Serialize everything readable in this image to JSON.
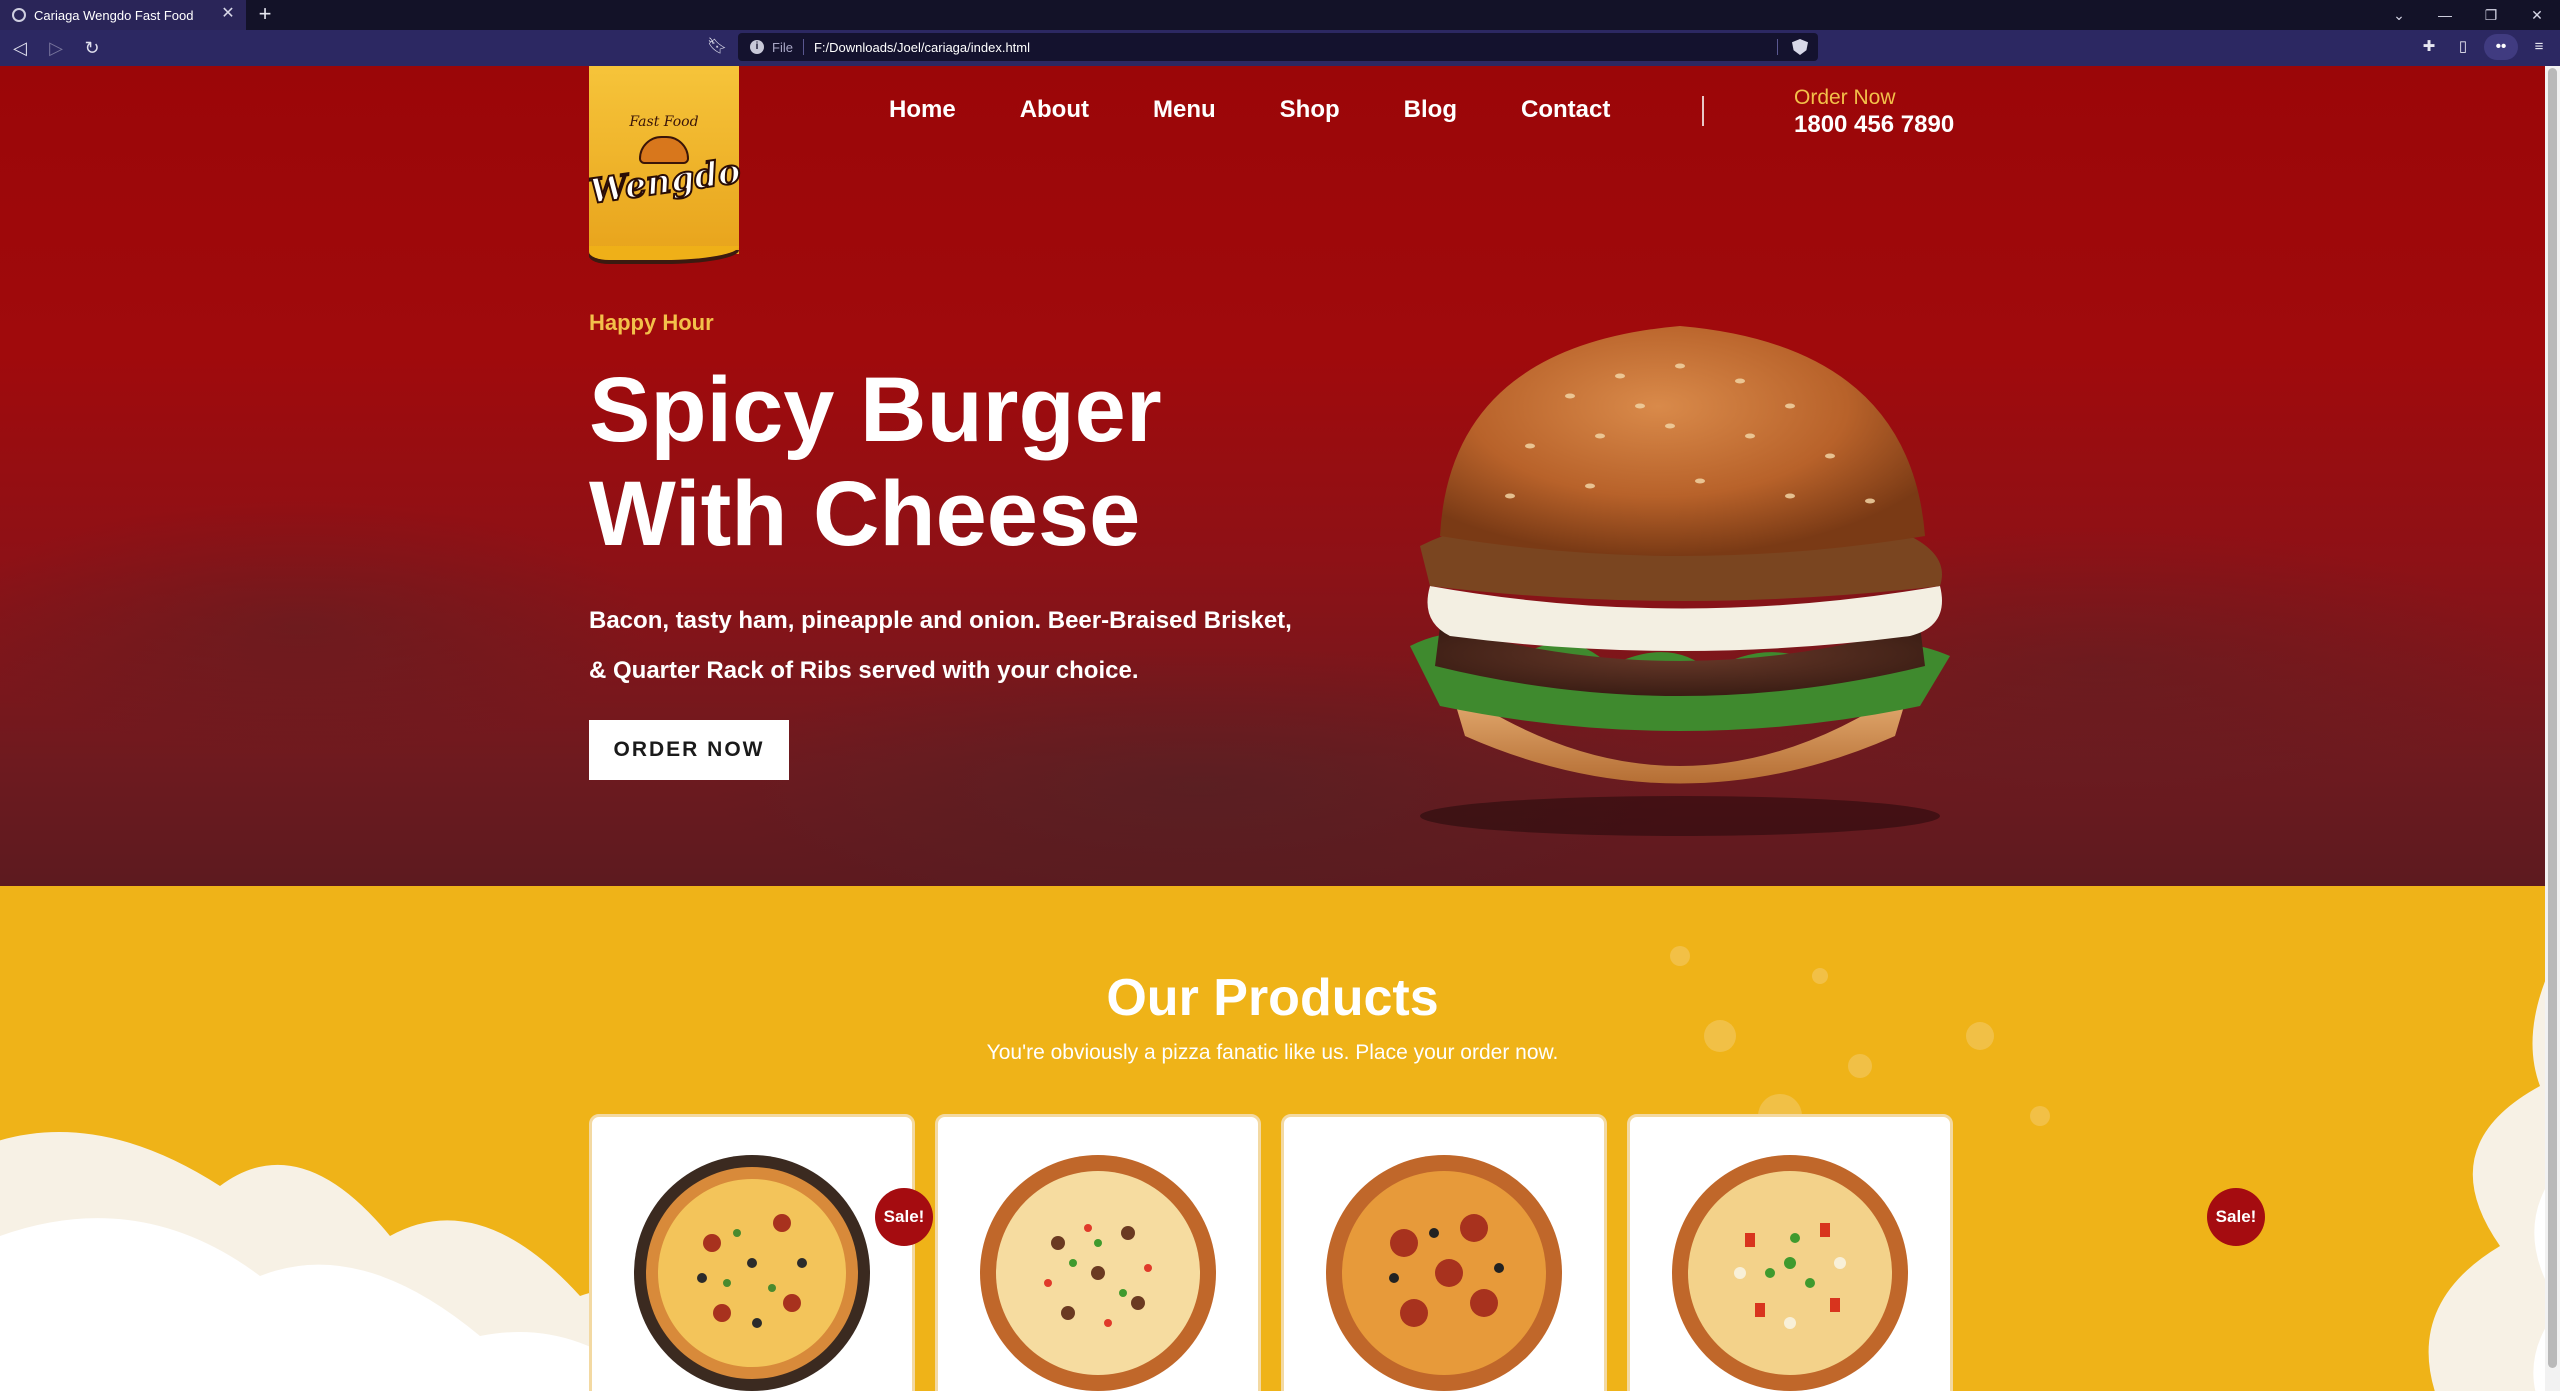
{
  "browser": {
    "tab_title": "Cariaga Wengdo Fast Food",
    "new_tab": "+",
    "tab_close": "✕",
    "url_scheme": "File",
    "url": "F:/Downloads/Joel/cariaga/index.html",
    "window_controls": {
      "minimize": "—",
      "restore": "❐",
      "close": "✕",
      "tabsearch": "⌄"
    }
  },
  "site": {
    "logo": {
      "small_text": "Fast Food",
      "brand": "Wengdo"
    },
    "nav": [
      "Home",
      "About",
      "Menu",
      "Shop",
      "Blog",
      "Contact"
    ],
    "order": {
      "label": "Order Now",
      "phone": "1800 456 7890"
    }
  },
  "hero": {
    "kicker": "Happy Hour",
    "headline_line1": "Spicy Burger",
    "headline_line2": "With Cheese",
    "desc_line1": "Bacon, tasty ham, pineapple and onion. Beer-Braised Brisket,",
    "desc_line2": "& Quarter Rack of Ribs served with your choice.",
    "cta": "ORDER NOW"
  },
  "products": {
    "title": "Our Products",
    "subtitle": "You're obviously a pizza fanatic like us. Place your order now.",
    "sale_label": "Sale!",
    "cards": [
      {
        "on_sale": true
      },
      {
        "on_sale": false
      },
      {
        "on_sale": false
      },
      {
        "on_sale": false
      }
    ]
  },
  "colors": {
    "hero_red": "#9b0608",
    "accent_gold": "#efb318",
    "kicker": "#f3c04a",
    "sale_badge": "#a50c10",
    "browser_toolbar": "#2c2862"
  }
}
